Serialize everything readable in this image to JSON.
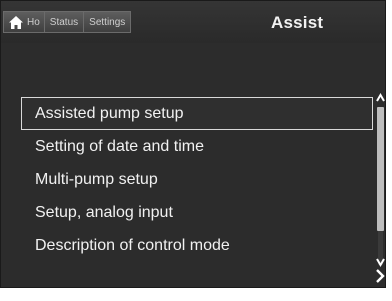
{
  "header": {
    "tabs": [
      {
        "label": "Ho",
        "icon": "home-icon"
      },
      {
        "label": "Status"
      },
      {
        "label": "Settings"
      }
    ],
    "title": "Assist"
  },
  "menu": {
    "items": [
      {
        "label": "Assisted pump setup",
        "selected": true
      },
      {
        "label": "Setting of date and time",
        "selected": false
      },
      {
        "label": "Multi-pump setup",
        "selected": false
      },
      {
        "label": "Setup, analog input",
        "selected": false
      },
      {
        "label": "Description of control mode",
        "selected": false
      }
    ]
  },
  "scrollbar": {
    "up_icon": "chevron-up-icon",
    "down_icon": "chevron-down-icon",
    "next_icon": "chevron-right-icon"
  },
  "colors": {
    "screen_background": "#2c2c2c",
    "text": "#f1f1f1",
    "selection_border": "#d9d9d9"
  }
}
